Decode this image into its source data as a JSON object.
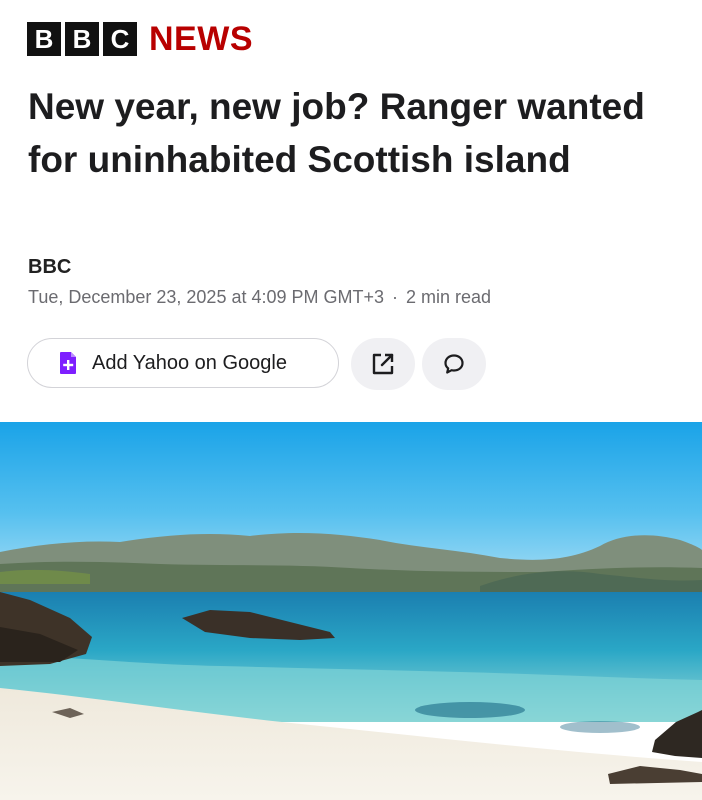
{
  "brand": {
    "letters": [
      "B",
      "B",
      "C"
    ],
    "news_word": "NEWS",
    "accent_color": "#b80000"
  },
  "article": {
    "headline": "New year, new job? Ranger wanted for uninhabited Scottish island",
    "source": "BBC",
    "date": "Tue, December 23, 2025 at 4:09 PM GMT+3",
    "separator": "·",
    "read_time": "2 min read"
  },
  "actions": {
    "add_google_label": "Add Yahoo on Google",
    "add_google_icon": "google-doc-plus-icon",
    "share_icon": "share-external-icon",
    "comment_icon": "comment-bubble-icon",
    "icon_color": "#7e1fff"
  },
  "hero_image": {
    "subject": "island-beach-photo"
  }
}
